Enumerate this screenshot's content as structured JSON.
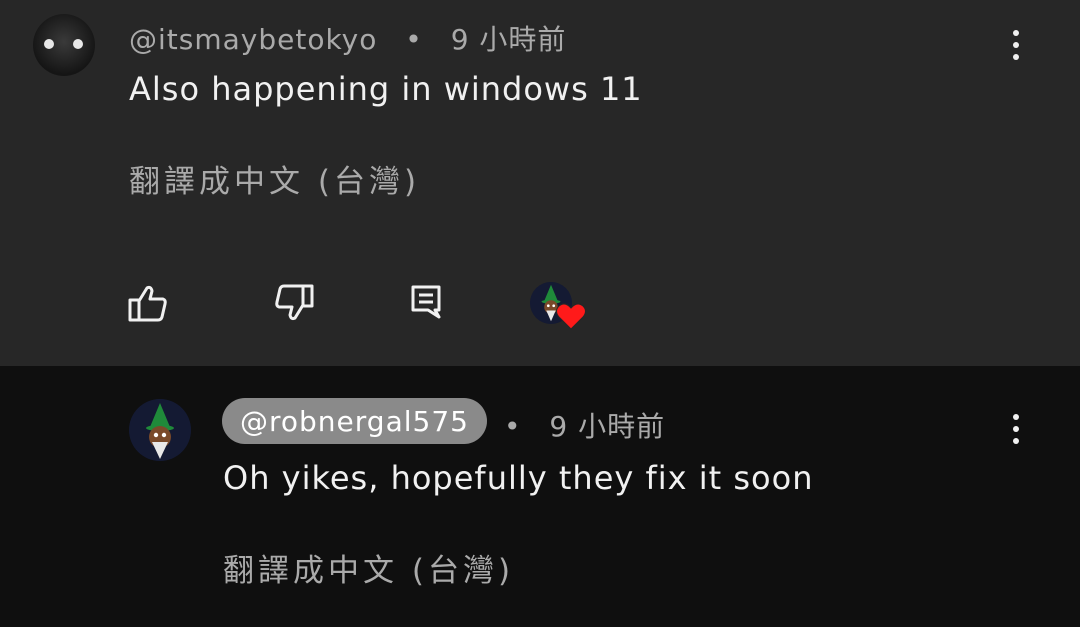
{
  "comment": {
    "avatar_icon": "user-avatar-icon",
    "author": "@itsmaybetokyo",
    "separator": "•",
    "time": "9 小時前",
    "text": "Also happening in windows 11",
    "translate_label": "翻譯成中文 (台灣)",
    "actions": {
      "like_icon": "thumbs-up-icon",
      "dislike_icon": "thumbs-down-icon",
      "reply_icon": "reply-icon",
      "creator_heart_icon": "creator-heart-icon"
    },
    "more_icon": "more-vertical-icon"
  },
  "reply": {
    "avatar_icon": "wizard-avatar-icon",
    "author": "@robnergal575",
    "separator": "•",
    "time": "9 小時前",
    "text": "Oh yikes, hopefully they fix it soon",
    "translate_label": "翻譯成中文 (台灣)",
    "more_icon": "more-vertical-icon"
  },
  "colors": {
    "top_background": "#272727",
    "reply_background": "#0f0f0f",
    "handle_chip": "#8a8a8a",
    "heart": "#ff1a1a"
  }
}
